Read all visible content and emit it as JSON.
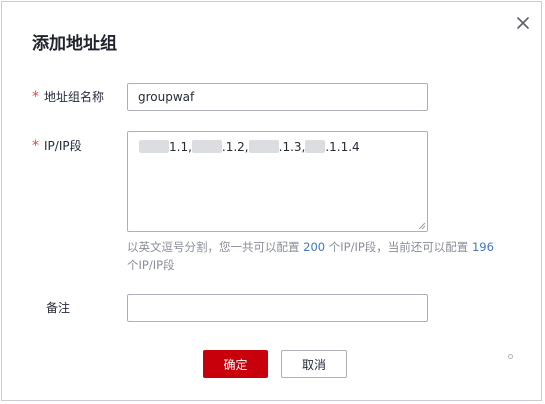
{
  "dialog": {
    "title": "添加地址组",
    "close_icon": "close-icon",
    "name_field": {
      "required_mark": "*",
      "label": "地址组名称",
      "value": "groupwaf"
    },
    "ip_field": {
      "required_mark": "*",
      "label": "IP/IP段",
      "segments": [
        {
          "suffix": "1.1,"
        },
        {
          "suffix": ".1.2,"
        },
        {
          "suffix": ".1.3,"
        },
        {
          "suffix": ".1.1.4"
        }
      ],
      "hint": {
        "part1": "以英文逗号分割，您一共可以配置 ",
        "max_count": "200",
        "part2": " 个IP/IP段，当前还可以配置 ",
        "remaining_count": "196",
        "part3": "个IP/IP段"
      }
    },
    "remark_field": {
      "label": "备注",
      "value": ""
    },
    "buttons": {
      "confirm": "确定",
      "cancel": "取消"
    },
    "colors": {
      "primary": "#c7000b",
      "required": "#e54545",
      "link_number": "#4277c2"
    }
  }
}
